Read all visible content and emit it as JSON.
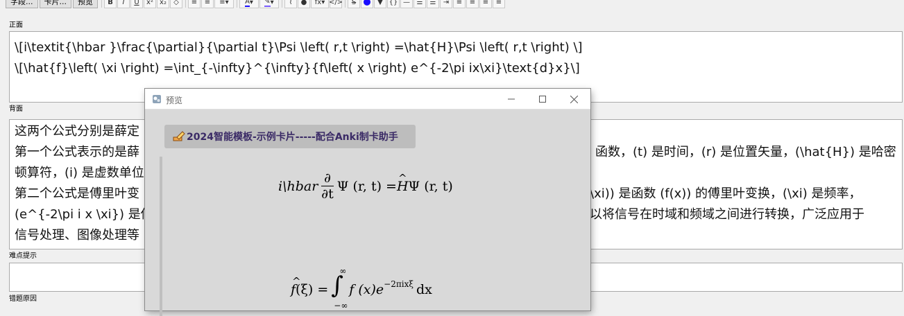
{
  "toolbar": {
    "fields_label": "字段...",
    "cards_label": "卡片...",
    "preview_label": "预览",
    "icons": [
      "bold-icon",
      "italic-icon",
      "underline-icon",
      "superscript-icon",
      "subscript-icon",
      "eraser-icon",
      "bulleted-list-icon",
      "numbered-list-icon",
      "align-icon",
      "text-color-icon",
      "highlight-color-icon",
      "attach-icon",
      "record-audio-icon",
      "formula-icon",
      "html-editor-icon",
      "strikethrough-icon",
      "blue-dot-icon",
      "triangle-icon",
      "braces-icon",
      "horizontal-rule-icon",
      "list-a-icon",
      "list-b-icon",
      "indent-icon",
      "align-left-icon",
      "align-center-icon",
      "align-right-icon",
      "justify-icon"
    ]
  },
  "fields": {
    "front": {
      "label": "正面",
      "lines": [
        "\\[i\\textit{\\hbar }\\frac{\\partial}{\\partial t}\\Psi \\left( r,t \\right) =\\hat{H}\\Psi \\left( r,t \\right) \\]",
        "\\[\\hat{f}\\left( \\xi \\right) =\\int_{-\\infty}^{\\infty}{f\\left( x \\right) e^{-2\\pi ix\\xi}\\text{d}x}\\]"
      ]
    },
    "back": {
      "label": "背面",
      "lines_left": [
        "这两个公式分别是薛定",
        "第一个公式表示的是薛",
        "顿算符，(i) 是虚数单位",
        "第二个公式是傅里叶变",
        "(e^{-2\\pi i x \\xi}) 是傅",
        "信号处理、图像处理等"
      ],
      "lines_right": [
        "",
        "函数，(t) 是时间，(r) 是位置矢量，(\\hat{H}) 是哈密",
        "",
        "\\xi)) 是函数 (f(x)) 的傅里叶变换，(\\xi) 是频率，",
        "以将信号在时域和频域之间进行转换，广泛应用于",
        ""
      ]
    },
    "hint": {
      "label": "难点提示",
      "value": ""
    },
    "error": {
      "label": "错题原因"
    }
  },
  "preview": {
    "title": "预览",
    "badge": "2024智能模板-示例卡片-----配合Anki制卡助手",
    "formula1": {
      "lhs_i": "i",
      "hbar": "\\hbar",
      "partial": "∂",
      "partial_t": "∂t",
      "rest": "Ψ (r, t) = ",
      "H": "H",
      "rest2": "Ψ (r, t)"
    },
    "formula2": {
      "f": "f",
      "arg": "(ξ) = ",
      "upper": "∞",
      "integral": "∫",
      "lower": "−∞",
      "body": "f (x)e",
      "exp": "−2πixξ",
      "dx": "dx"
    }
  },
  "colors": {
    "accent_blue": "#1a0dff",
    "badge_text": "#3a2a66",
    "field_border": "#a9a9a9"
  }
}
